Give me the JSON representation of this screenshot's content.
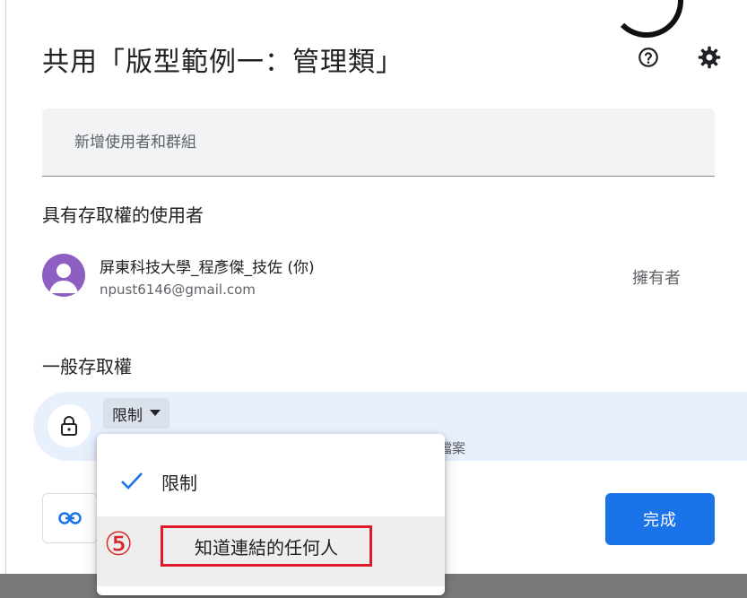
{
  "dialog": {
    "title": "共用「版型範例一：管理類」",
    "help_icon": "help-circle-icon",
    "settings_icon": "gear-icon"
  },
  "add_people": {
    "placeholder": "新增使用者和群組"
  },
  "people_section": {
    "label": "具有存取權的使用者",
    "users": [
      {
        "name": "屏東科技大學_程彥傑_技佐 (你)",
        "email": "npust6146@gmail.com",
        "role": "擁有者"
      }
    ]
  },
  "general_access": {
    "label": "一般存取權",
    "selected": "限制",
    "description_partial": "檔案"
  },
  "dropdown_menu": {
    "items": [
      {
        "label": "限制",
        "checked": true
      },
      {
        "label": "知道連結的任何人",
        "checked": false,
        "highlighted": true
      }
    ]
  },
  "annotation": {
    "step_marker": "⑤",
    "highlight_color": "#e0192b"
  },
  "footer": {
    "copy_link_icon": "link-icon",
    "done_label": "完成"
  },
  "colors": {
    "accent": "#1a73e8",
    "avatar": "#8e5fc2",
    "access_row": "#e8f0fe"
  }
}
